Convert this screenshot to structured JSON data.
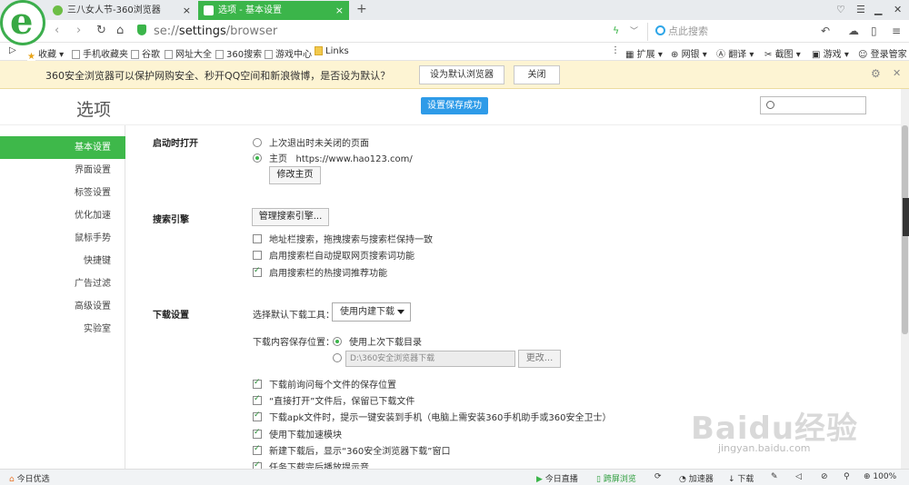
{
  "tabs": [
    {
      "title": "三八女人节-360浏览器",
      "close": "×"
    },
    {
      "title": "选项 - 基本设置",
      "close": "×"
    }
  ],
  "new_tab": "+",
  "address": {
    "scheme": "se://",
    "host": "settings",
    "path": "/browser"
  },
  "search_placeholder": "点此搜索",
  "bookmarks": [
    "收藏",
    "手机收藏夹",
    "谷歌",
    "网址大全",
    "360搜索",
    "游戏中心",
    "Links"
  ],
  "toolbar_items": [
    "扩展",
    "网银",
    "翻译",
    "截图",
    "游戏",
    "登录管家"
  ],
  "notice": {
    "text": "360安全浏览器可以保护网购安全、秒开QQ空间和新浪微博，是否设为默认？",
    "set_default": "设为默认浏览器",
    "close": "关闭"
  },
  "page_title": "选项",
  "saved_badge": "设置保存成功",
  "sidebar": [
    "基本设置",
    "界面设置",
    "标签设置",
    "优化加速",
    "鼠标手势",
    "快捷键",
    "广告过滤",
    "高级设置",
    "实验室"
  ],
  "startup": {
    "heading": "启动时打开",
    "opt_last": "上次退出时未关闭的页面",
    "opt_home": "主页",
    "home_url": "https://www.hao123.com/",
    "edit_home": "修改主页"
  },
  "search_engine": {
    "heading": "搜索引擎",
    "manage": "管理搜索引擎...",
    "opt1": "地址栏搜索，拖拽搜索与搜索栏保持一致",
    "opt2": "启用搜索栏自动提取网页搜索词功能",
    "opt3": "启用搜索栏的热搜词推荐功能"
  },
  "download": {
    "heading": "下载设置",
    "tool_label": "选择默认下载工具：",
    "tool_value": "使用内建下载",
    "location_label": "下载内容保存位置：",
    "use_last": "使用上次下载目录",
    "path": "D:\\360安全浏览器下载",
    "change": "更改...",
    "opt1": "下载前询问每个文件的保存位置",
    "opt2": "“直接打开”文件后，保留已下载文件",
    "opt3": "下载apk文件时，提示一键安装到手机（电脑上需安装360手机助手或360安全卫士）",
    "opt4": "使用下载加速模块",
    "opt5": "新建下载后，显示“360安全浏览器下载”窗口",
    "opt6": "任务下载完后播放提示音"
  },
  "statusbar": {
    "left": "今日优选",
    "live": "今日直播",
    "cross": "跨屏浏览",
    "accel": "加速器",
    "download": "下载",
    "zoom": "100%"
  },
  "watermark": {
    "brand": "Baidu经验",
    "url": "jingyan.baidu.com"
  }
}
